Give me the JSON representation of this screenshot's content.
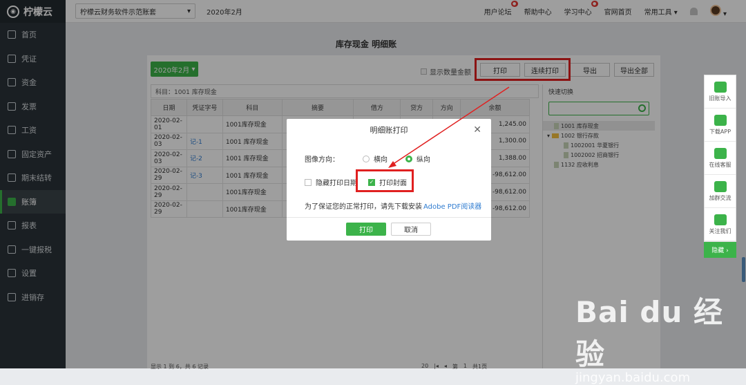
{
  "app": {
    "logo": "柠檬云"
  },
  "sidebar": {
    "items": [
      {
        "label": "首页"
      },
      {
        "label": "凭证"
      },
      {
        "label": "资金"
      },
      {
        "label": "发票"
      },
      {
        "label": "工资"
      },
      {
        "label": "固定资产"
      },
      {
        "label": "期末结转"
      },
      {
        "label": "账簿"
      },
      {
        "label": "报表"
      },
      {
        "label": "一键报税"
      },
      {
        "label": "设置"
      },
      {
        "label": "进销存"
      }
    ]
  },
  "topbar": {
    "account": "柠檬云财务软件示范账套",
    "period": "2020年2月",
    "links": [
      "用户论坛",
      "帮助中心",
      "学习中心",
      "官网首页",
      "常用工具"
    ]
  },
  "page": {
    "title": "库存现金 明细账"
  },
  "toolbar": {
    "date": "2020年2月",
    "show_qty": "显示数量金额",
    "print": "打印",
    "cont_print": "连续打印",
    "export": "导出",
    "export_all": "导出全部"
  },
  "subject_line": "科目：1001 库存现金",
  "table": {
    "headers": [
      "日期",
      "凭证字号",
      "科目",
      "摘要",
      "借方",
      "贷方",
      "方向",
      "余额"
    ],
    "rows": [
      {
        "date": "2020-02-01",
        "voucher": "",
        "subject": "1001库存现金",
        "balance": "1,245.00"
      },
      {
        "date": "2020-02-03",
        "voucher": "记-1",
        "subject": "1001 库存现金",
        "balance": "1,300.00"
      },
      {
        "date": "2020-02-03",
        "voucher": "记-2",
        "subject": "1001 库存现金",
        "balance": "1,388.00"
      },
      {
        "date": "2020-02-29",
        "voucher": "记-3",
        "subject": "1001 库存现金",
        "balance": "-98,612.00"
      },
      {
        "date": "2020-02-29",
        "voucher": "",
        "subject": "1001库存现金",
        "balance": "-98,612.00"
      },
      {
        "date": "2020-02-29",
        "voucher": "",
        "subject": "1001库存现金",
        "balance": "-98,612.00"
      }
    ]
  },
  "quick_switch": {
    "title": "快速切换",
    "items": [
      "1001 库存现金",
      "1002 银行存款",
      "1002001 华夏银行",
      "1002002 招商银行",
      "1132 应收利息"
    ]
  },
  "pager": {
    "info": "显示 1 到 6，共 6 记录",
    "page_size": "20",
    "page_label": "第",
    "page": "1",
    "total": "共1页"
  },
  "dialog": {
    "title": "明细账打印",
    "orientation_label": "图像方向：",
    "landscape": "横向",
    "portrait": "纵向",
    "hide_date": "隐藏打印日期",
    "print_cover": "打印封面",
    "note": "为了保证您的正常打印，请先下载安装",
    "note_link": "Adobe PDF阅读器",
    "ok": "打印",
    "cancel": "取消"
  },
  "rightbar": {
    "items": [
      "旧账导入",
      "下载APP",
      "在线客服",
      "加群交流",
      "关注我们"
    ],
    "hide": "隐藏 ›"
  },
  "watermark": {
    "brand": "Bai du 经验",
    "url": "jingyan.baidu.com"
  }
}
